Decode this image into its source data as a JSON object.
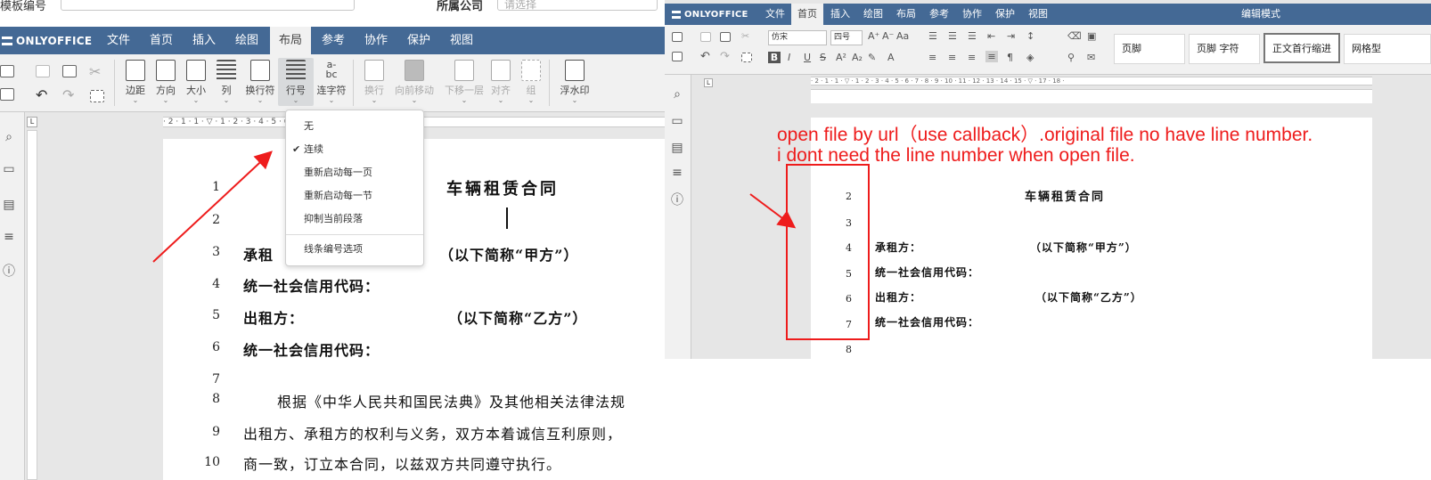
{
  "left": {
    "top_strip": {
      "label1": "模板编号",
      "label2": "所属公司",
      "placeholder": "请选择"
    },
    "app": {
      "logo": "ONLYOFFICE"
    },
    "tabs": [
      "文件",
      "首页",
      "插入",
      "绘图",
      "布局",
      "参考",
      "协作",
      "保护",
      "视图"
    ],
    "active_tab": "布局",
    "toolbar": {
      "margins": "边距",
      "orientation": "方向",
      "size": "大小",
      "columns": "列",
      "breaks": "换行符",
      "line_numbers": "行号",
      "hyphenation": "连字符",
      "wrap": "换行",
      "bring_forward": "向前移动",
      "send_backward": "下移一层",
      "align": "对齐",
      "group": "组",
      "watermark": "浮水印",
      "hyphen_icon_top": "a-",
      "hyphen_icon_bottom": "bc"
    },
    "ruler_marks": "· 2 · 1 · 1 · ▽ · 1 · 2 · 3 · 4 · 5 · 6 · 7 · 8 · 9 · 10 · 11 · 12 ·",
    "dropdown": {
      "items": [
        "无",
        "连续",
        "重新启动每一页",
        "重新启动每一节",
        "抑制当前段落"
      ],
      "checked_index": 1,
      "options": "线条编号选项"
    },
    "document": {
      "title": "车辆租赁合同",
      "line_numbers": [
        "1",
        "2",
        "3",
        "4",
        "5",
        "6",
        "7",
        "8",
        "9",
        "10"
      ],
      "lessee": "承租",
      "lessee_abbr": "（以下简称“甲方”）",
      "credit_code": "统一社会信用代码：",
      "lessor": "出租方：",
      "lessor_abbr": "（以下简称“乙方”）",
      "credit_code2": "统一社会信用代码：",
      "body1": "根据《中华人民共和国民法典》及其他相关法律法规",
      "body2": "出租方、承租方的权利与义务，双方本着诚信互利原则，",
      "body3": "商一致，订立本合同，以兹双方共同遵守执行。"
    }
  },
  "right": {
    "app": {
      "logo": "ONLYOFFICE",
      "mode": "编辑模式"
    },
    "tabs": [
      "文件",
      "首页",
      "插入",
      "绘图",
      "布局",
      "参考",
      "协作",
      "保护",
      "视图"
    ],
    "active_tab": "首页",
    "font_name": "仿宋",
    "font_size": "四号",
    "styles": [
      "页脚",
      "页脚 字符",
      "正文首行缩进",
      "网格型"
    ],
    "ruler_marks": "· 2 · 1 · 1 · ▽ · 1 · 2 · 3 · 4 · 5 · 6 · 7 · 8 · 9 · 10 · 11 · 12 · 13 · 14 · 15 · ▽ · 17 · 18 ·",
    "document": {
      "title": "车辆租赁合同",
      "line_numbers": [
        "2",
        "3",
        "4",
        "5",
        "6",
        "7",
        "8"
      ],
      "lessee": "承租方：",
      "lessee_abbr": "（以下简称“甲方”）",
      "credit_code": "统一社会信用代码：",
      "lessor": "出租方：",
      "lessor_abbr": "（以下简称“乙方”）",
      "credit_code2": "统一社会信用代码："
    },
    "annotation": {
      "line1": "open file by url（use callback）.original file no have line number.",
      "line2": "i dont need the line number when open file."
    }
  },
  "colors": {
    "brand_bar": "#446995",
    "annotation": "#ee1c1c"
  }
}
